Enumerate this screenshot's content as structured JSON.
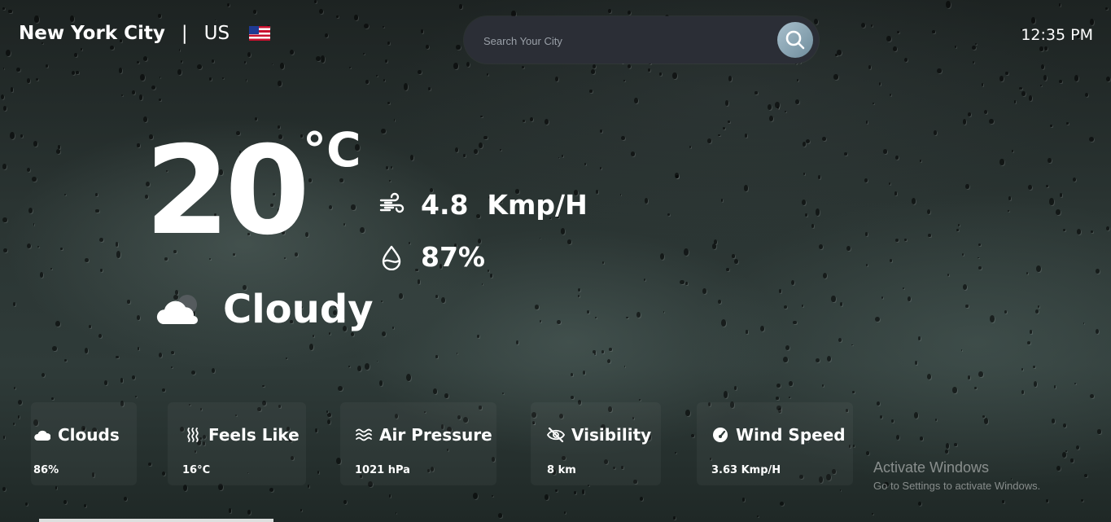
{
  "header": {
    "city": "New York City",
    "separator": "|",
    "country": "US",
    "flag_icon": "us-flag-icon",
    "time": "12:35 PM"
  },
  "search": {
    "placeholder": "Search Your City",
    "value": "",
    "button_icon": "search-icon"
  },
  "current": {
    "temperature": "20",
    "unit": "°C",
    "wind": "4.8  Kmp/H",
    "wind_icon": "wind-icon",
    "humidity": "87%",
    "humidity_icon": "droplet-icon",
    "condition": "Cloudy",
    "condition_icon": "cloud-icon"
  },
  "details": [
    {
      "title": "Clouds",
      "value": "86%",
      "icon": "cloud-icon"
    },
    {
      "title": "Feels Like",
      "value": "16°C",
      "icon": "heat-waves-icon"
    },
    {
      "title": "Air Pressure",
      "value": "1021 hPa",
      "icon": "waves-icon"
    },
    {
      "title": "Visibility",
      "value": "8 km",
      "icon": "eye-slash-icon"
    },
    {
      "title": "Wind Speed",
      "value": "3.63 Kmp/H",
      "icon": "gauge-icon"
    }
  ],
  "watermark": {
    "line1": "Activate Windows",
    "line2": "Go to Settings to activate Windows."
  },
  "colors": {
    "search_bg": "#2b2e36",
    "search_button": "#8aa6b4",
    "text": "#ffffff"
  }
}
